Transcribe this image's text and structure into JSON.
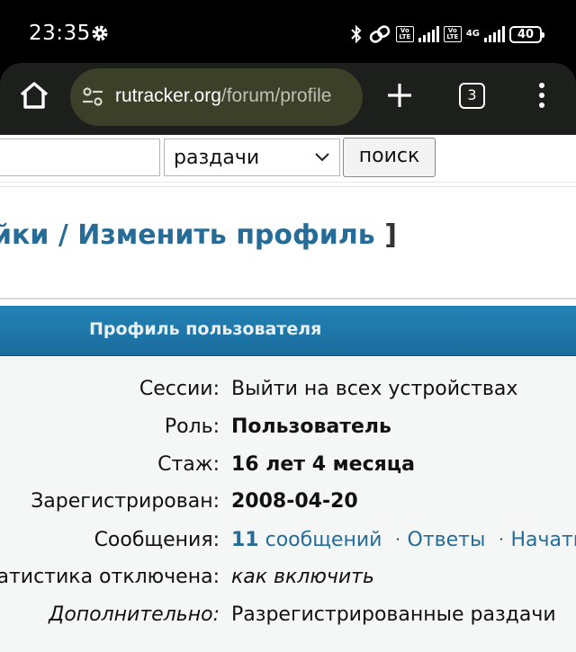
{
  "statusbar": {
    "time": "23:35",
    "battery": "40",
    "network": "4G",
    "icons": [
      "gear-icon",
      "bluetooth-icon",
      "link-icon",
      "volte-icon",
      "signal-icon",
      "battery-icon"
    ]
  },
  "browser": {
    "url_host": "rutracker.org",
    "url_path": "/forum/profile",
    "tab_count": "3"
  },
  "search": {
    "input_value": "",
    "select_value": "раздачи",
    "button_label": "поиск"
  },
  "page": {
    "title_visible": "йки / Изменить профиль",
    "title_bracket": "]"
  },
  "profile": {
    "header": "Профиль пользователя",
    "rows": [
      {
        "label": "Сессии:",
        "value": "Выйти на всех устройствах"
      },
      {
        "label": "Роль:",
        "value": "Пользователь"
      },
      {
        "label": "Стаж:",
        "value": "16 лет 4 месяца"
      },
      {
        "label": "Зарегистрирован:",
        "value": "2008-04-20"
      },
      {
        "label": "Сообщения:",
        "count": "11",
        "messages_link": "сообщений",
        "dot": "·",
        "answers_link": "Ответы",
        "started_link": "Начатые"
      },
      {
        "label": "Статистика отключена:",
        "value": "как включить"
      },
      {
        "label": "Дополнительно:",
        "value": "Разрегистрированные раздачи"
      }
    ]
  },
  "colors": {
    "link": "#266c98",
    "header_blue": "#1f78aa",
    "urlbar": "#3c4029"
  }
}
